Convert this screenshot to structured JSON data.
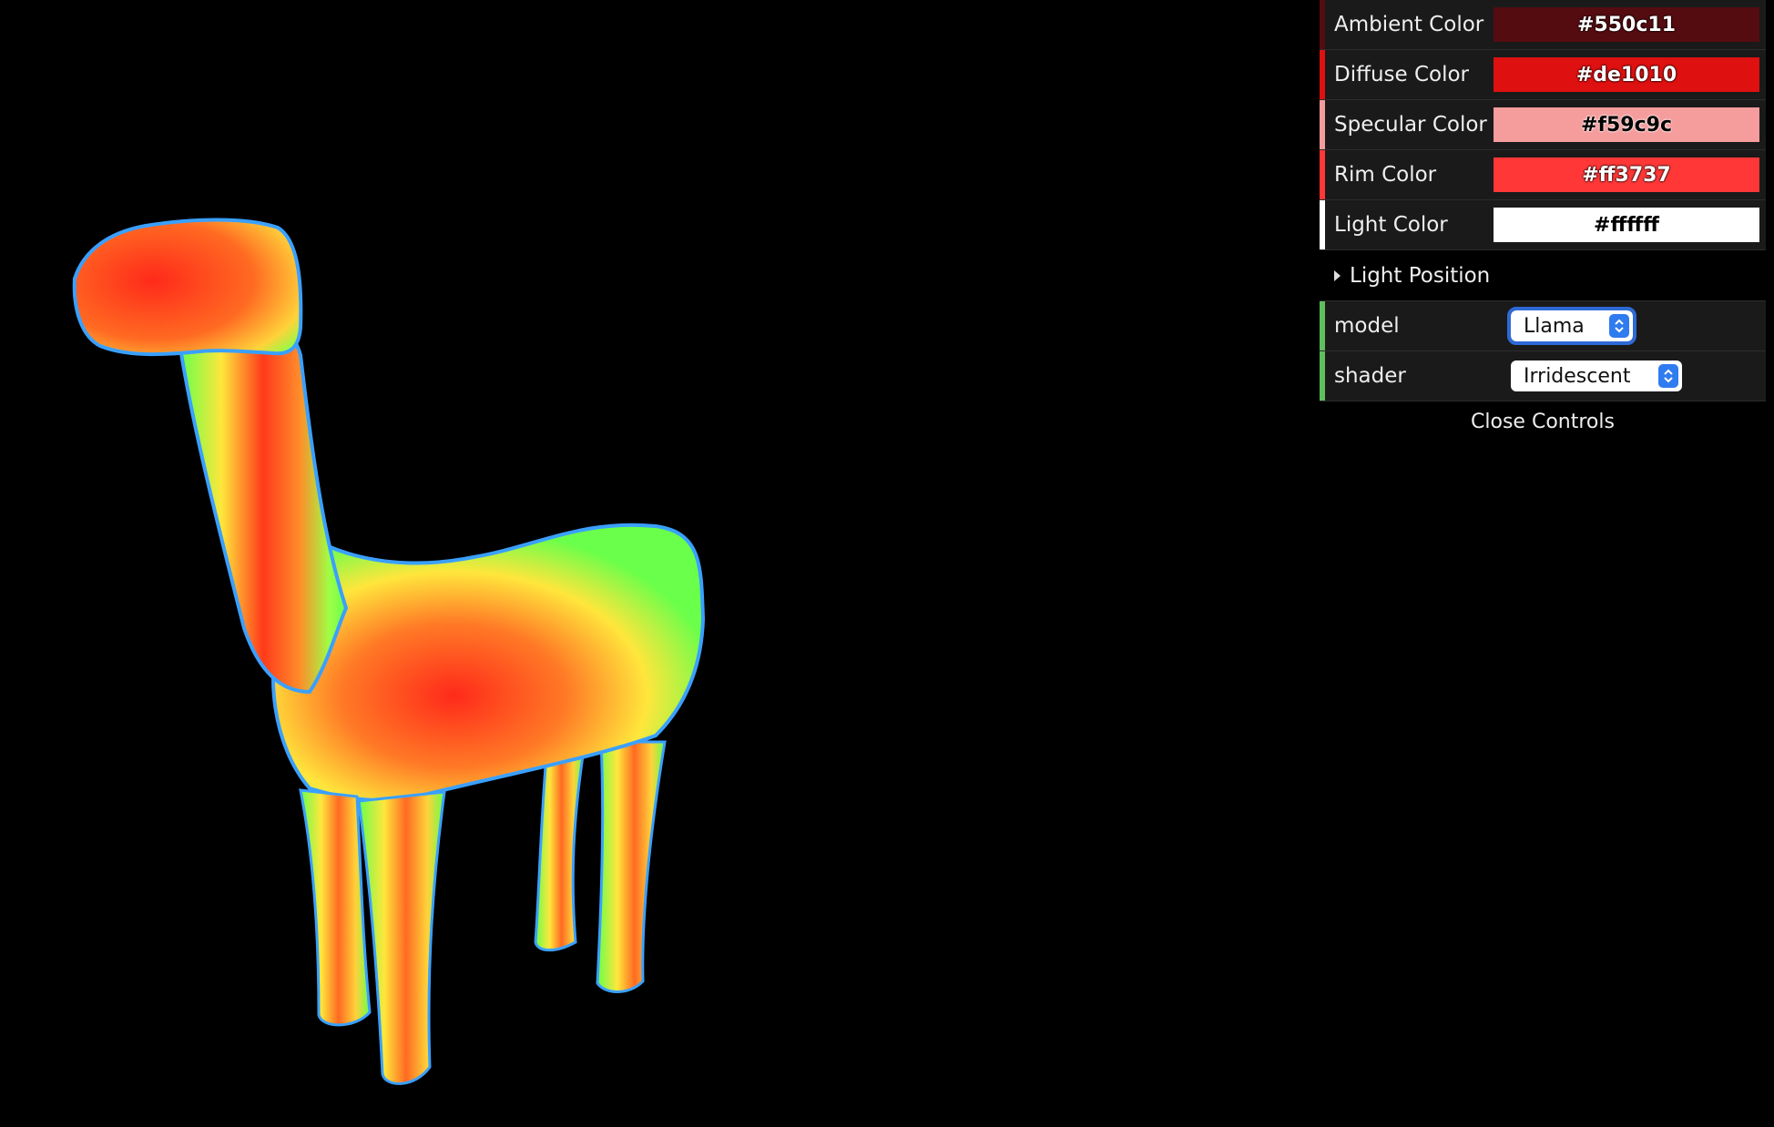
{
  "gui": {
    "colors": [
      {
        "label": "Ambient Color",
        "value": "#550c11",
        "stripe": "#550c11",
        "text_dark": false
      },
      {
        "label": "Diffuse Color",
        "value": "#de1010",
        "stripe": "#de1010",
        "text_dark": false
      },
      {
        "label": "Specular Color",
        "value": "#f59c9c",
        "stripe": "#f59c9c",
        "text_dark": true
      },
      {
        "label": "Rim Color",
        "value": "#ff3737",
        "stripe": "#ff3737",
        "text_dark": false
      },
      {
        "label": "Light Color",
        "value": "#ffffff",
        "stripe": "#ffffff",
        "text_dark": true
      }
    ],
    "folder": {
      "label": "Light Position",
      "icon": "triangle-right-icon"
    },
    "model": {
      "label": "model",
      "value": "Llama",
      "stripe": "#5fbf5f"
    },
    "shader": {
      "label": "shader",
      "value": "Irridescent",
      "stripe": "#5fbf5f"
    },
    "close_label": "Close Controls"
  },
  "scene": {
    "subject": "llama-model",
    "palette": [
      "#ff2a1a",
      "#ffe63c",
      "#6aff4a",
      "#3aa0ff"
    ]
  }
}
